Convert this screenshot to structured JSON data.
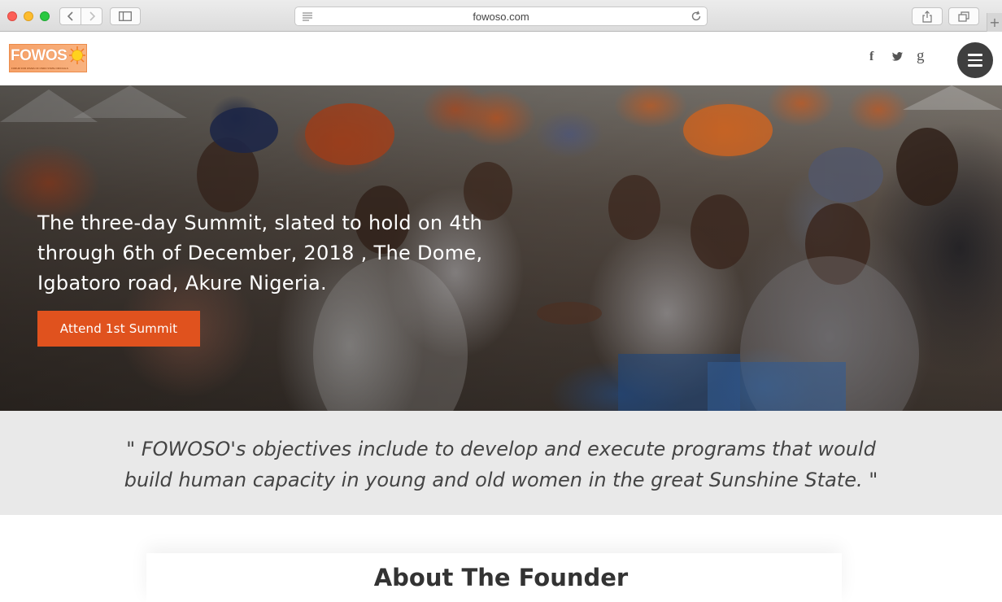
{
  "browser": {
    "url": "fowoso.com",
    "new_tab_symbol": "+"
  },
  "header": {
    "logo_text": "FOWOS",
    "logo_tagline": "FORUM FOR WIVES OF ONDO STATE OFFICIALS",
    "social": {
      "facebook": "f",
      "twitter": "🐦",
      "google": "g"
    }
  },
  "hero": {
    "text": "The three-day Summit, slated to hold on 4th through 6th of December, 2018 , The Dome, Igbatoro road, Akure Nigeria.",
    "button_label": "Attend 1st Summit"
  },
  "quote": {
    "line1": "\"  FOWOSO's objectives include to develop and execute programs that would",
    "line2": "build human capacity in young and old women in the great Sunshine State.  \""
  },
  "about": {
    "title": "About The Founder"
  },
  "colors": {
    "accent": "#e0521e",
    "menu_button": "#3f3f3f",
    "quote_band": "#e9e9e9"
  }
}
